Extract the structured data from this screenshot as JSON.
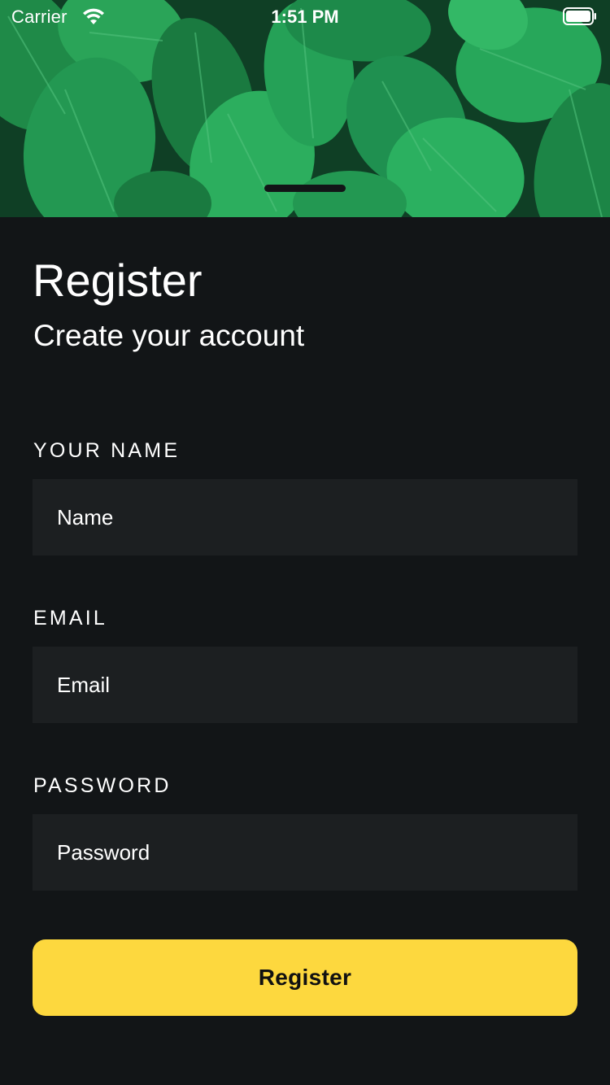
{
  "status_bar": {
    "carrier": "Carrier",
    "time": "1:51 PM",
    "wifi_icon": "wifi-icon",
    "battery_icon": "battery-icon"
  },
  "hero": {
    "image": "green-leaves-photo"
  },
  "header": {
    "title": "Register",
    "subtitle": "Create your account"
  },
  "form": {
    "name": {
      "label": "YOUR NAME",
      "placeholder": "Name",
      "value": ""
    },
    "email": {
      "label": "EMAIL",
      "placeholder": "Email",
      "value": ""
    },
    "password": {
      "label": "PASSWORD",
      "placeholder": "Password",
      "value": ""
    }
  },
  "actions": {
    "register_label": "Register"
  },
  "colors": {
    "background": "#121517",
    "input_background": "#1c1f21",
    "accent": "#fdd83e",
    "text": "#ffffff"
  }
}
